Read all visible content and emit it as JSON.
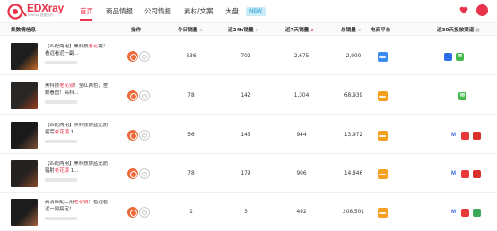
{
  "brand": {
    "name": "EDXray",
    "tagline": "EdsRay 数据分析",
    "primary_color": "#e8334a"
  },
  "nav": {
    "items": [
      {
        "label": "首页",
        "active": true
      },
      {
        "label": "商品情报",
        "active": false
      },
      {
        "label": "公司情报",
        "active": false
      },
      {
        "label": "素材/文案",
        "active": false
      },
      {
        "label": "大盘",
        "active": false
      }
    ],
    "new_badge": "NEW"
  },
  "table": {
    "headers": {
      "info": "集数情信息",
      "ops": "操作",
      "today": "今日销量",
      "h24": "近24h销量",
      "d7": "近7天销量",
      "total": "总销量",
      "platform": "电商平台",
      "ads": "近30天投放渠道"
    },
    "rows": [
      {
        "title_pre": "【匹配两用】黑科技",
        "title_hl": "老花",
        "title_post": "镜！看远看近一副...",
        "today": "336",
        "h24": "702",
        "d7": "2,675",
        "total": "2,900",
        "platform_color": "#3b8cf0",
        "ads": [
          "baidu-icon",
          "wechat-icon"
        ]
      },
      {
        "title_pre": "黑科技",
        "title_hl": "老花镜",
        "title_post": "！全红两色，舍数看图！高科...",
        "today": "78",
        "h24": "142",
        "d7": "1,304",
        "total": "68,939",
        "platform_color": "#f5a020",
        "ads": [
          "wechat-icon"
        ]
      },
      {
        "title_pre": "【匹配两用】黑科技防蓝光防疲劳",
        "title_hl": "老花镜",
        "title_post": " 1...",
        "today": "56",
        "h24": "145",
        "d7": "944",
        "total": "13,972",
        "platform_color": "#f5a020",
        "ads": [
          "toutiao-icon",
          "ad-red-icon",
          "ad-red2-icon"
        ]
      },
      {
        "title_pre": "【匹配两用】黑科技防蓝光防辐射",
        "title_hl": "老花镜",
        "title_post": " 1...",
        "today": "78",
        "h24": "179",
        "d7": "906",
        "total": "14,846",
        "platform_color": "#f5a020",
        "ads": [
          "toutiao-icon",
          "ad-red-icon",
          "ad-red2-icon"
        ]
      },
      {
        "title_pre": "高清匹配三用",
        "title_hl": "老花镜",
        "title_post": "！看远看近一副搞定！...",
        "today": "1",
        "h24": "3",
        "d7": "492",
        "total": "208,501",
        "platform_color": "#f5a020",
        "ads": [
          "toutiao-icon",
          "ad-red-icon",
          "ad-green-icon"
        ]
      }
    ]
  }
}
